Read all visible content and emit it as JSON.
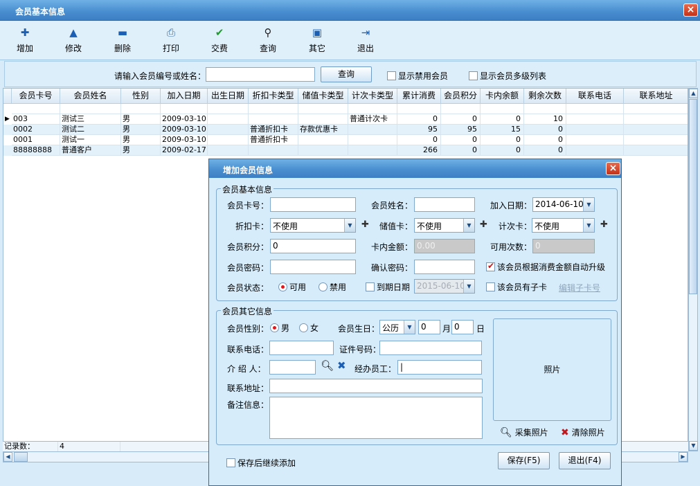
{
  "window": {
    "title": "会员基本信息"
  },
  "toolbar": {
    "items": [
      {
        "label": "增加",
        "icon": "plus-icon",
        "glyph": "✚",
        "color": "#1a5fb4"
      },
      {
        "label": "修改",
        "icon": "triangle-up-icon",
        "glyph": "▲",
        "color": "#1a5fb4"
      },
      {
        "label": "删除",
        "icon": "minus-icon",
        "glyph": "▬",
        "color": "#1a5fb4"
      },
      {
        "label": "打印",
        "icon": "printer-icon",
        "glyph": "⎙",
        "color": "#3a6ea5"
      },
      {
        "label": "交费",
        "icon": "check-icon",
        "glyph": "✔",
        "color": "#1f9a2e"
      },
      {
        "label": "查询",
        "icon": "binoculars-icon",
        "glyph": "⚲",
        "color": "#222222"
      },
      {
        "label": "其它",
        "icon": "square-icon",
        "glyph": "▣",
        "color": "#1a5fb4"
      },
      {
        "label": "退出",
        "icon": "exit-icon",
        "glyph": "⇥",
        "color": "#1a5fb4"
      }
    ]
  },
  "search": {
    "label": "请输入会员编号或姓名：",
    "value": "",
    "button": "查询",
    "show_disabled": "显示禁用会员",
    "show_multilevel": "显示会员多级列表"
  },
  "grid": {
    "columns": [
      "会员卡号",
      "会员姓名",
      "性别",
      "加入日期",
      "出生日期",
      "折扣卡类型",
      "储值卡类型",
      "计次卡类型",
      "累计消费",
      "会员积分",
      "卡内余额",
      "剩余次数",
      "联系电话",
      "联系地址"
    ],
    "rows": [
      [
        "003",
        "测试三",
        "男",
        "2009-03-10",
        "",
        "",
        "",
        "普通计次卡",
        "0",
        "0",
        "0",
        "10",
        "",
        ""
      ],
      [
        "0002",
        "测试二",
        "男",
        "2009-03-10",
        "",
        "普通折扣卡",
        "存款优惠卡",
        "",
        "95",
        "95",
        "15",
        "0",
        "",
        ""
      ],
      [
        "0001",
        "测试一",
        "男",
        "2009-03-10",
        "",
        "普通折扣卡",
        "",
        "",
        "0",
        "0",
        "0",
        "0",
        "",
        ""
      ],
      [
        "88888888",
        "普通客户",
        "男",
        "2009-02-17",
        "",
        "",
        "",
        "",
        "266",
        "0",
        "0",
        "0",
        "",
        ""
      ]
    ],
    "footer_label": "记录数：",
    "footer_count": "4"
  },
  "dialog": {
    "title": "增加会员信息",
    "basic_group": "会员基本信息",
    "card_no_label": "会员卡号：",
    "card_no_value": "",
    "name_label": "会员姓名：",
    "name_value": "",
    "join_date_label": "加入日期：",
    "join_date_value": "2014-06-10",
    "discount_label": "折扣卡：",
    "discount_value": "不使用",
    "stored_label": "储值卡：",
    "stored_value": "不使用",
    "count_label": "计次卡：",
    "count_value": "不使用",
    "points_label": "会员积分：",
    "points_value": "0",
    "balance_label": "卡内金额：",
    "balance_value": "0.00",
    "times_label": "可用次数：",
    "times_value": "0",
    "password_label": "会员密码：",
    "confirm_label": "确认密码：",
    "auto_upgrade": "该会员根据消费金额自动升级",
    "status_label": "会员状态：",
    "status_on": "可用",
    "status_off": "禁用",
    "expire_label": "到期日期",
    "expire_value": "2015-06-10",
    "has_sub": "该会员有子卡",
    "edit_sub": "编辑子卡号",
    "other_group": "会员其它信息",
    "gender_label": "会员性别：",
    "gender_male": "男",
    "gender_female": "女",
    "birthday_label": "会员生日：",
    "calendar_value": "公历",
    "birth_month": "0",
    "month_unit": "月",
    "birth_day": "0",
    "day_unit": "日",
    "phone_label": "联系电话：",
    "id_label": "证件号码：",
    "referrer_label": "介 绍 人：",
    "staff_label": "经办员工：",
    "address_label": "联系地址：",
    "note_label": "备注信息：",
    "photo_label": "照片",
    "capture_photo": "采集照片",
    "clear_photo": "清除照片",
    "keep_adding": "保存后继续添加",
    "save": "保存(F5)",
    "exit": "退出(F4)"
  }
}
